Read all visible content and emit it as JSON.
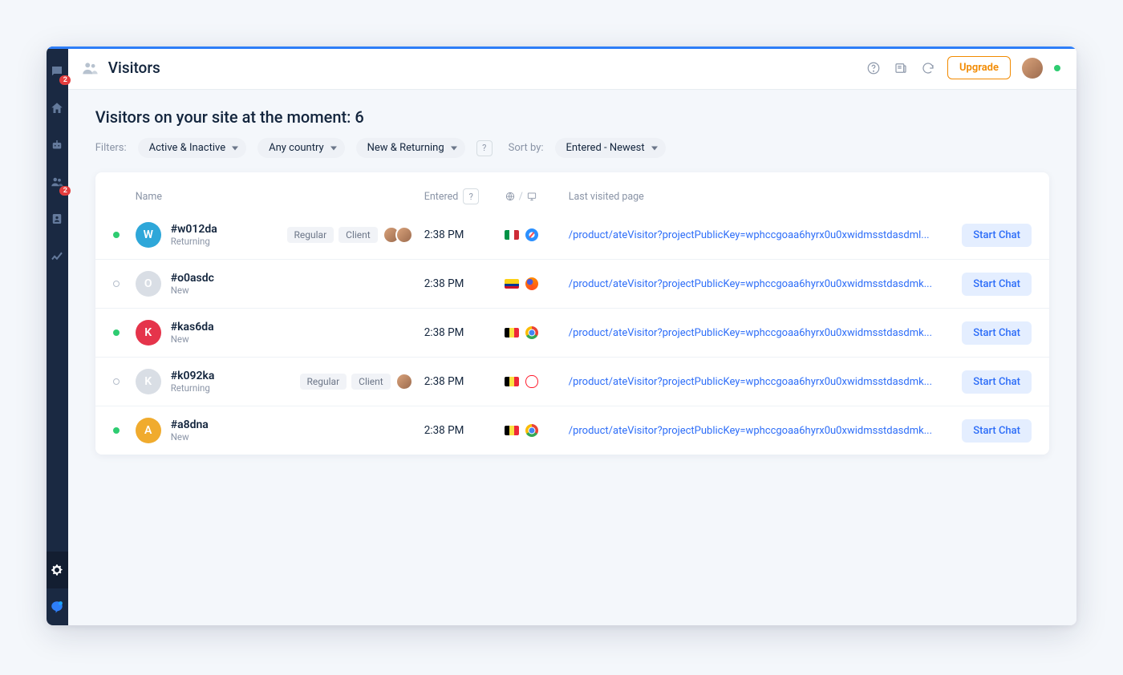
{
  "sidebar": {
    "chat_badge": "2",
    "visitor_badge": "2"
  },
  "header": {
    "title": "Visitors",
    "upgrade": "Upgrade"
  },
  "page": {
    "heading_prefix": "Visitors on your site at the moment: ",
    "visitor_count": "6"
  },
  "filters": {
    "label": "Filters:",
    "activity": "Active & Inactive",
    "country": "Any country",
    "type": "New & Returning",
    "help": "?",
    "sort_label": "Sort by:",
    "sort_value": "Entered - Newest"
  },
  "table": {
    "headers": {
      "name": "Name",
      "entered": "Entered",
      "entered_help": "?",
      "loc_sep": "/",
      "page": "Last visited page"
    },
    "rows": [
      {
        "presence": "active",
        "avatar_letter": "W",
        "avatar_color": "#2ea7d9",
        "name": "#w012da",
        "status": "Returning",
        "tags": [
          "Regular",
          "Client"
        ],
        "assignees": 2,
        "time": "2:38 PM",
        "flag": "flag-it",
        "browser": "b-safari",
        "page": "/product/ateVisitor?projectPublicKey=wphccgoaa6hyrx0u0xwidmsstdasdml...",
        "action": "Start Chat"
      },
      {
        "presence": "idle",
        "avatar_letter": "O",
        "avatar_color": "#d9dee5",
        "name": "#o0asdc",
        "status": "New",
        "tags": [],
        "assignees": 0,
        "time": "2:38 PM",
        "flag": "flag-co",
        "browser": "b-firefox",
        "page": "/product/ateVisitor?projectPublicKey=wphccgoaa6hyrx0u0xwidmsstdasdmk...",
        "action": "Start Chat"
      },
      {
        "presence": "active",
        "avatar_letter": "K",
        "avatar_color": "#e5344b",
        "name": "#kas6da",
        "status": "New",
        "tags": [],
        "assignees": 0,
        "time": "2:38 PM",
        "flag": "flag-be",
        "browser": "b-chrome",
        "page": "/product/ateVisitor?projectPublicKey=wphccgoaa6hyrx0u0xwidmsstdasdmk...",
        "action": "Start Chat"
      },
      {
        "presence": "idle",
        "avatar_letter": "K",
        "avatar_color": "#d9dee5",
        "name": "#k092ka",
        "status": "Returning",
        "tags": [
          "Regular",
          "Client"
        ],
        "assignees": 1,
        "time": "2:38 PM",
        "flag": "flag-be",
        "browser": "b-opera",
        "page": "/product/ateVisitor?projectPublicKey=wphccgoaa6hyrx0u0xwidmsstdasdmk...",
        "action": "Start Chat"
      },
      {
        "presence": "active",
        "avatar_letter": "A",
        "avatar_color": "#f0ab2e",
        "name": "#a8dna",
        "status": "New",
        "tags": [],
        "assignees": 0,
        "time": "2:38 PM",
        "flag": "flag-be",
        "browser": "b-chrome",
        "page": "/product/ateVisitor?projectPublicKey=wphccgoaa6hyrx0u0xwidmsstdasdmk...",
        "action": "Start Chat"
      }
    ]
  }
}
